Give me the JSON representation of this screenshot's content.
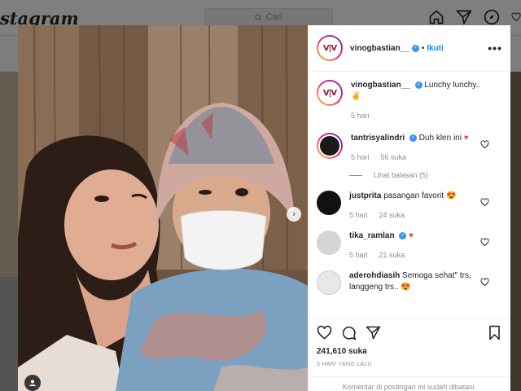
{
  "background": {
    "logo": "stagram",
    "search_placeholder": "Cari"
  },
  "post": {
    "author": "vinogbastian__",
    "follow_label": "Ikuti",
    "separator": "•",
    "more_label": "•••",
    "caption": "Lunchy lunchy..",
    "caption_emoji": "✌️",
    "caption_time": "5 hari",
    "avatar_text": "V|V"
  },
  "comments": [
    {
      "user": "tantrisyalindri",
      "verified": true,
      "text": "Duh klen ini",
      "emoji": "♥",
      "time": "5 hari",
      "likes": "56 suka"
    },
    {
      "user": "justprita",
      "verified": false,
      "text": "pasangan favorit",
      "emoji": "😍",
      "time": "5 hari",
      "likes": "24 suka"
    },
    {
      "user": "tika_ramlan",
      "verified": true,
      "text": "",
      "emoji": "♥",
      "time": "5 hari",
      "likes": "21 suka"
    },
    {
      "user": "aderohdiasih",
      "verified": false,
      "text": "Semoga sehat\" trs, langgeng trs..",
      "emoji": "😍",
      "time": "",
      "likes": ""
    }
  ],
  "replies_label": "Lihat balasan (5)",
  "likes_count": "241,610 suka",
  "date_label": "5 HARI YANG LALU",
  "comments_closed": "Komentar di postingan ini sudah dibatasi.",
  "colors": {
    "accent": "#0095f6",
    "verified": "#3897f0",
    "heart": "#ed4956"
  }
}
